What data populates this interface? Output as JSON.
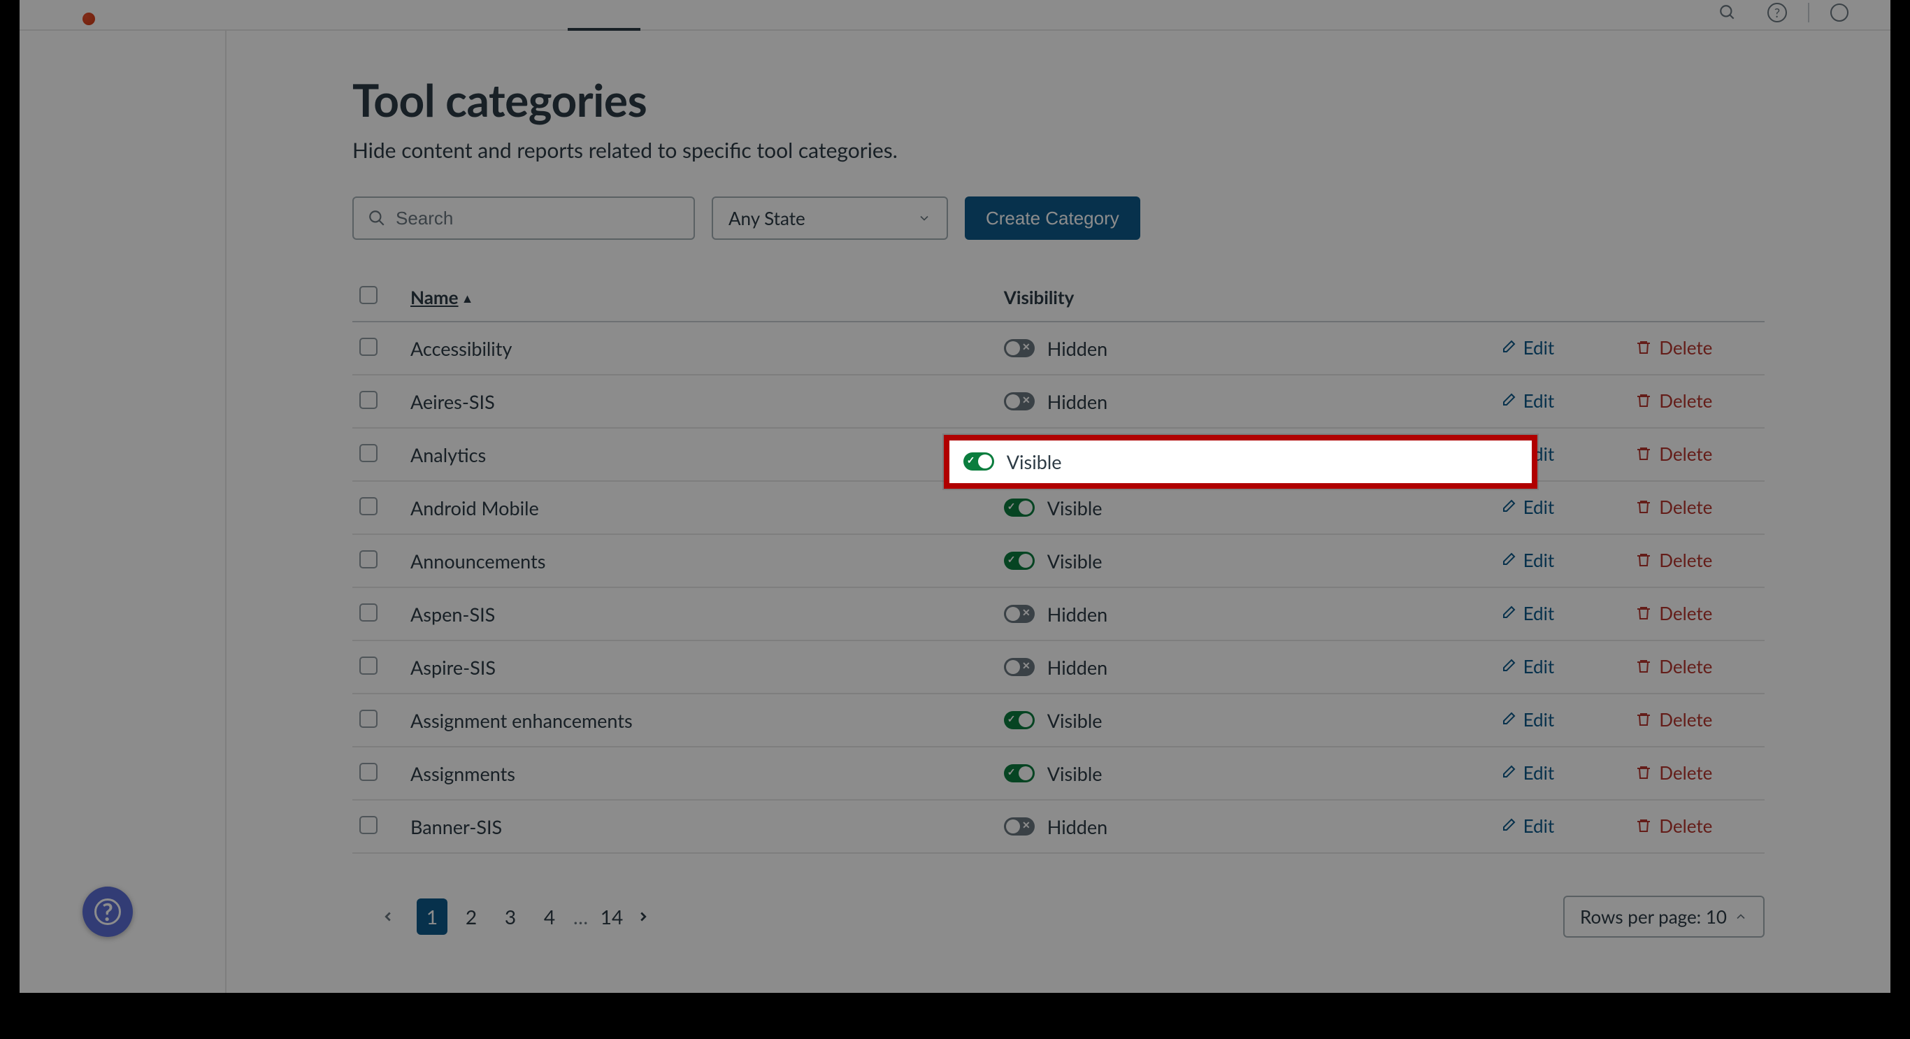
{
  "page": {
    "title": "Tool categories",
    "subtitle": "Hide content and reports related to specific tool categories."
  },
  "controls": {
    "search_placeholder": "Search",
    "state_selected": "Any State",
    "create_label": "Create Category"
  },
  "table": {
    "col_name": "Name",
    "col_visibility": "Visibility",
    "edit_label": "Edit",
    "delete_label": "Delete",
    "visible_label": "Visible",
    "hidden_label": "Hidden"
  },
  "rows": [
    {
      "name": "Accessibility",
      "visible": false
    },
    {
      "name": "Aeires-SIS",
      "visible": false
    },
    {
      "name": "Analytics",
      "visible": true
    },
    {
      "name": "Android Mobile",
      "visible": true
    },
    {
      "name": "Announcements",
      "visible": true
    },
    {
      "name": "Aspen-SIS",
      "visible": false
    },
    {
      "name": "Aspire-SIS",
      "visible": false
    },
    {
      "name": "Assignment enhancements",
      "visible": true
    },
    {
      "name": "Assignments",
      "visible": true
    },
    {
      "name": "Banner-SIS",
      "visible": false
    }
  ],
  "pagination": {
    "pages": [
      "1",
      "2",
      "3",
      "4",
      "14"
    ],
    "active": "1",
    "ellipsis": "…",
    "rows_per_page_label": "Rows per page: 10"
  },
  "highlight": {
    "row_index": 2
  }
}
